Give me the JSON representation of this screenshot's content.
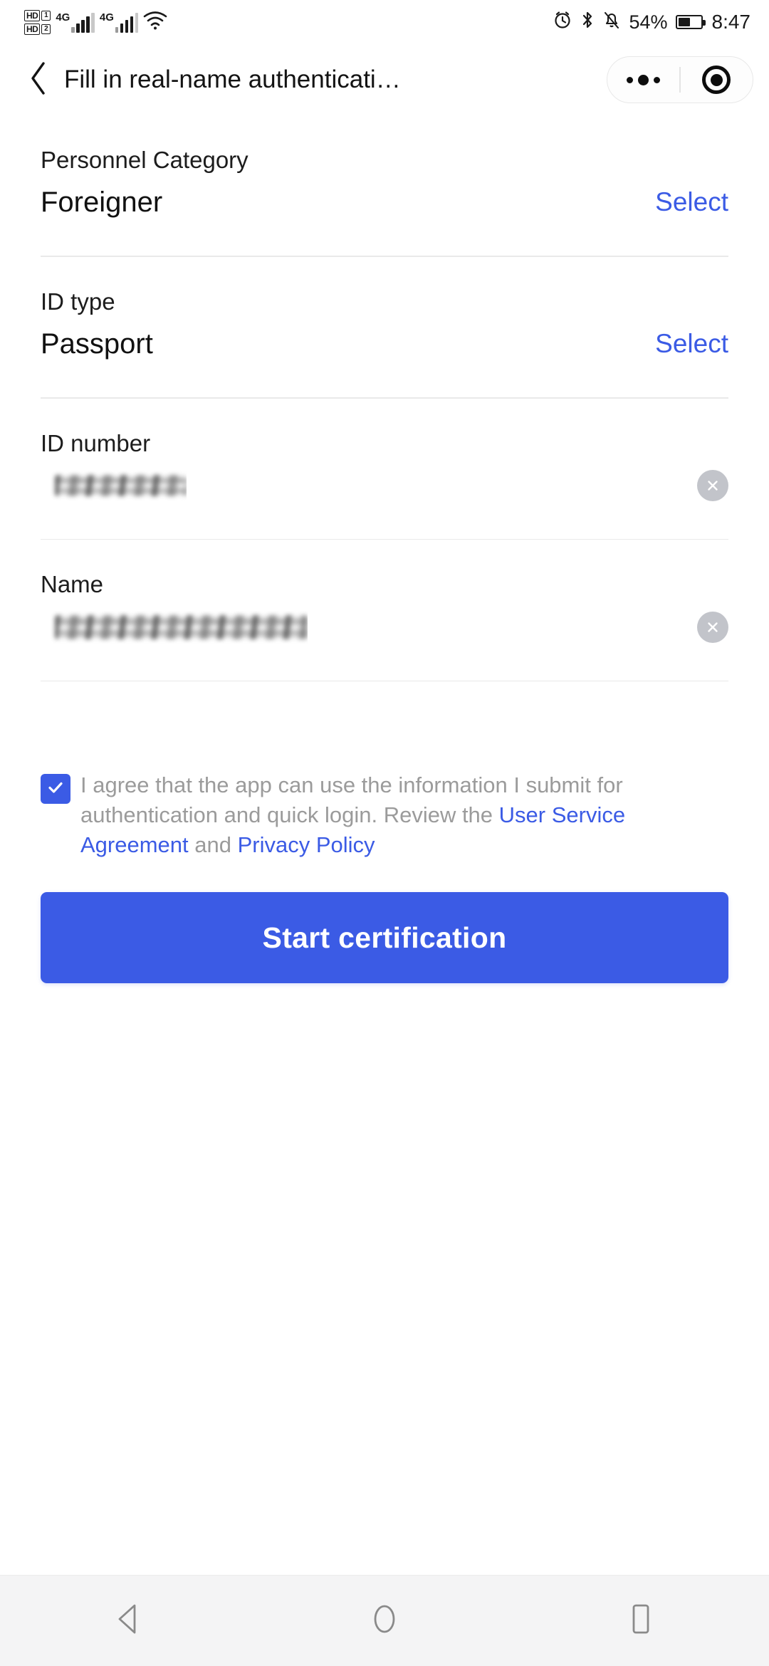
{
  "status_bar": {
    "hd_label_1": "HD",
    "sim_1": "1",
    "hd_label_2": "HD",
    "sim_2": "2",
    "network_1": "4G",
    "network_2": "4G",
    "wifi_icon": "wifi-icon",
    "alarm_icon": "alarm-icon",
    "bluetooth_icon": "bluetooth-icon",
    "mute_icon": "bell-muted-icon",
    "battery_percent": "54%",
    "battery_level": 54,
    "time": "8:47"
  },
  "nav_bar": {
    "back_icon": "chevron-left-icon",
    "title": "Fill in real-name authenticati…",
    "menu_icon": "more-dots-icon",
    "close_icon": "target-circle-icon"
  },
  "form": {
    "fields": [
      {
        "label": "Personnel Category",
        "value": "Foreigner",
        "action": "Select",
        "type": "select"
      },
      {
        "label": "ID type",
        "value": "Passport",
        "action": "Select",
        "type": "select"
      },
      {
        "label": "ID number",
        "value": "",
        "type": "input",
        "redacted": true,
        "clear_icon": "clear-circle-icon"
      },
      {
        "label": "Name",
        "value": "",
        "type": "input",
        "redacted": true,
        "clear_icon": "clear-circle-icon"
      }
    ]
  },
  "agreement": {
    "checked": true,
    "check_icon": "checkmark-icon",
    "text_part_1": "I agree that the app can use the information I submit for authentication and quick login. Review the ",
    "link_1": "User Service Agreement",
    "text_part_2": " and ",
    "link_2": "Privacy Policy"
  },
  "primary_button": {
    "label": "Start certification"
  },
  "system_nav": {
    "back_icon": "triangle-back-icon",
    "home_icon": "circle-home-icon",
    "recents_icon": "square-recents-icon"
  },
  "colors": {
    "accent_blue": "#3b5be5",
    "link_blue": "#3b5be5",
    "text_primary": "#111111",
    "text_secondary": "#9b9b9b",
    "divider": "#e9e9e9",
    "sys_nav_bg": "#f4f4f5"
  }
}
